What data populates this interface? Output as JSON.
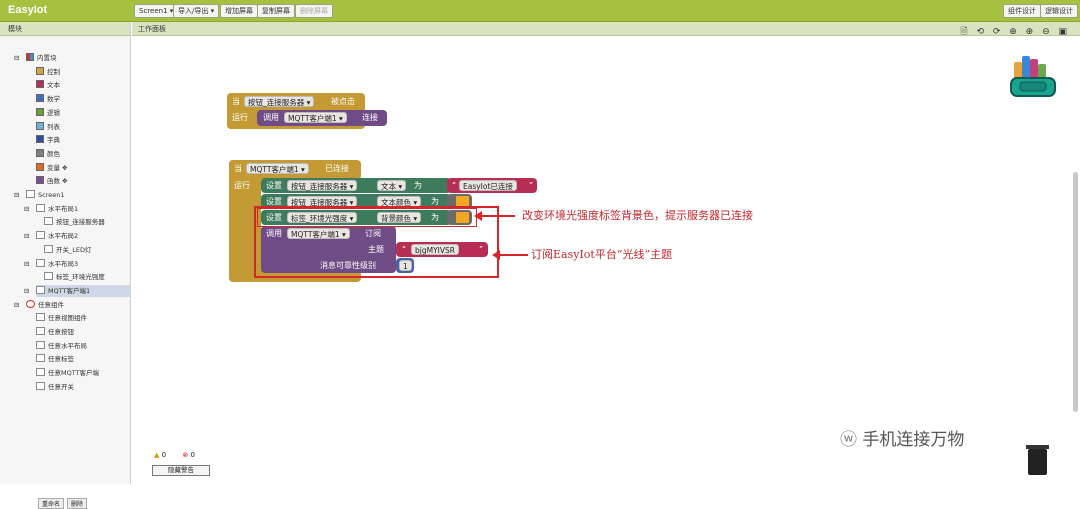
{
  "app": {
    "title": "EasyIot"
  },
  "toolbar": {
    "screen_select": "Screen1 ▾",
    "import_export": "导入/导出 ▾",
    "add_screen": "增加屏幕",
    "copy_screen": "复制屏幕",
    "delete_screen": "删除屏幕",
    "designer": "组件设计",
    "blocks": "逻辑设计"
  },
  "left_panel": {
    "title": "模块",
    "builtin": "内置块",
    "builtin_items": [
      {
        "label": "控制",
        "color": "#d1a63f"
      },
      {
        "label": "文本",
        "color": "#b32d5e"
      },
      {
        "label": "数学",
        "color": "#3f6fbf"
      },
      {
        "label": "逻辑",
        "color": "#6c9e3a"
      },
      {
        "label": "列表",
        "color": "#74b3d9"
      },
      {
        "label": "字典",
        "color": "#2f4fa5"
      },
      {
        "label": "颜色",
        "color": "#7f7f7f"
      },
      {
        "label": "变量",
        "color": "#e06b1c"
      },
      {
        "label": "函数",
        "color": "#7a4f92"
      }
    ],
    "screen": "Screen1",
    "components": [
      {
        "label": "水平布局1",
        "depth": 1
      },
      {
        "label": "按钮_连接服务器",
        "depth": 2
      },
      {
        "label": "水平布局2",
        "depth": 1
      },
      {
        "label": "开关_LED灯",
        "depth": 2
      },
      {
        "label": "水平布局3",
        "depth": 1
      },
      {
        "label": "标签_环境光强度",
        "depth": 2
      },
      {
        "label": "MQTT客户端1",
        "depth": 1
      }
    ],
    "any": "任意组件",
    "any_items": [
      "任意视图组件",
      "任意按钮",
      "任意水平布局",
      "任意标签",
      "任意MQTT客户端",
      "任意开关"
    ],
    "rename": "重命名",
    "delete": "删除"
  },
  "workspace": {
    "title": "工作面板",
    "tools": "🗎 ⟲ ⟳ ⊕ ⊕ ⊖ ▣",
    "block1": {
      "when": "当",
      "comp": "按钮_连接服务器 ▾",
      "event": "被点击",
      "do": "运行",
      "call": "调用",
      "target": "MQTT客户端1 ▾",
      "method": "连接"
    },
    "block2": {
      "when": "当",
      "comp": "MQTT客户端1 ▾",
      "event": "已连接",
      "do": "运行",
      "s1": {
        "set": "设置",
        "comp": "按钮_连接服务器 ▾",
        "prop": "文本 ▾",
        "to": "为",
        "value": "EasyIot已连接"
      },
      "s2": {
        "set": "设置",
        "comp": "按钮_连接服务器 ▾",
        "prop": "文本颜色 ▾",
        "to": "为"
      },
      "s3": {
        "set": "设置",
        "comp": "标签_环境光强度 ▾",
        "prop": "背景颜色 ▾",
        "to": "为"
      },
      "s4": {
        "call": "调用",
        "comp": "MQTT客户端1 ▾",
        "method": "订阅",
        "topic_label": "主题",
        "topic": "bjgMYIVSR",
        "qos_label": "消息可靠性级别",
        "qos": "1"
      }
    },
    "annotation1": "改变环境光强度标签背景色，提示服务器已连接",
    "annotation2": "订阅EasyIot平台“光线”主题",
    "warnings": "0",
    "errors": "0",
    "hide_warnings": "隐藏警告",
    "watermark": "手机连接万物"
  }
}
